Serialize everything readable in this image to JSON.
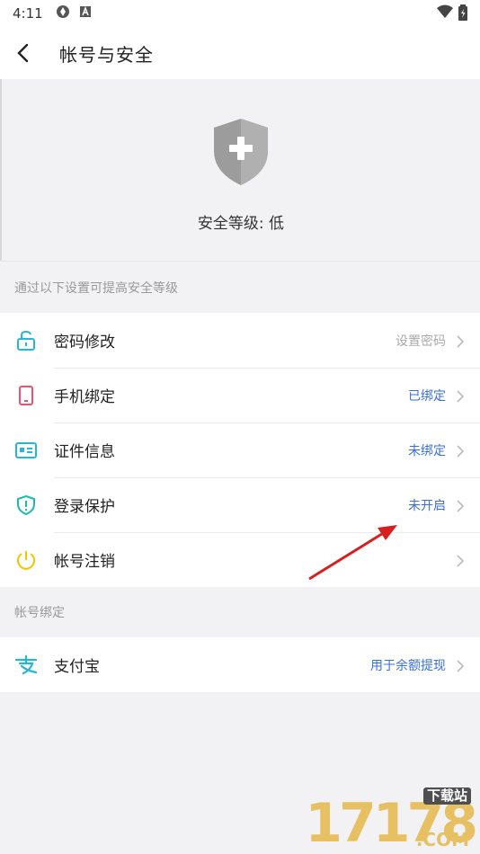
{
  "status_bar": {
    "time": "4:11"
  },
  "app_bar": {
    "title": "帐号与安全"
  },
  "security": {
    "level_text": "安全等级: 低"
  },
  "section1": {
    "title": "通过以下设置可提高安全等级"
  },
  "items": [
    {
      "label": "密码修改",
      "value": "设置密码",
      "icon": "unlock-icon",
      "value_color": "#aaaaaa"
    },
    {
      "label": "手机绑定",
      "value": "已绑定",
      "icon": "phone-icon",
      "value_color": "#3a6fd8"
    },
    {
      "label": "证件信息",
      "value": "未绑定",
      "icon": "id-card-icon",
      "value_color": "#3a6fd8"
    },
    {
      "label": "登录保护",
      "value": "未开启",
      "icon": "shield-exclamation-icon",
      "value_color": "#3a6fd8"
    },
    {
      "label": "帐号注销",
      "value": "",
      "icon": "power-icon"
    }
  ],
  "section2": {
    "title": "帐号绑定"
  },
  "bindings": [
    {
      "label": "支付宝",
      "value": "用于余额提现",
      "icon": "alipay-icon",
      "value_color": "#3a6fd8"
    }
  ],
  "watermark": {
    "number": "17178",
    "tag": "下载站",
    "suffix": ".COM"
  },
  "colors": {
    "accent_blue": "#3a6fd8",
    "icon_cyan": "#27b5d8",
    "icon_pink": "#f0506e",
    "icon_teal": "#1fb8b3",
    "icon_yellow": "#f5c400",
    "shield_gray": "#9c9c9c",
    "annotation_red": "#d61f1f"
  }
}
